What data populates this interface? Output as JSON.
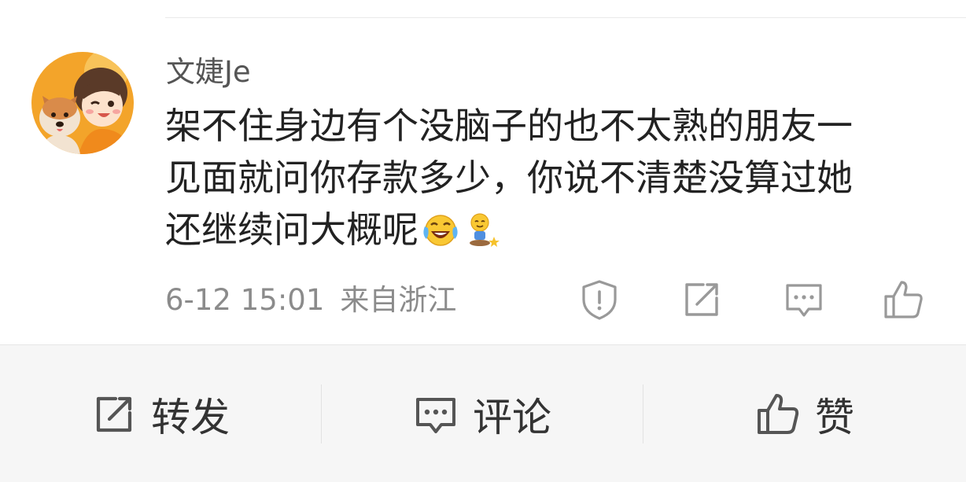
{
  "comment": {
    "username": "文婕Je",
    "text_lines": [
      "架不住身边有个没脑子的也不太熟的朋友一",
      "见面就问你存款多少，你说不清楚没算过她",
      "还继续问大概呢"
    ],
    "emojis": [
      "laughing-crying-emoji",
      "sitting-smile-emoji"
    ],
    "timestamp": "6-12 15:01",
    "location": "来自浙江",
    "actions": [
      "report-icon",
      "share-icon",
      "comment-icon",
      "like-icon"
    ]
  },
  "bottom_bar": {
    "repost_label": "转发",
    "comment_label": "评论",
    "like_label": "赞"
  },
  "colors": {
    "text": "#222222",
    "muted": "#8b8b8b",
    "username": "#555555",
    "bar_bg": "#f6f6f6",
    "avatar_bg": "#f3a42a"
  }
}
